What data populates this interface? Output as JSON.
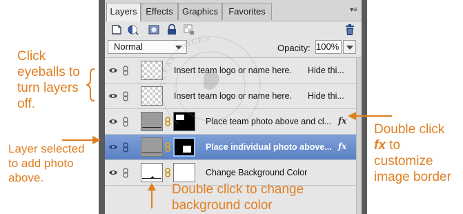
{
  "tabs": [
    "Layers",
    "Effects",
    "Graphics",
    "Favorites"
  ],
  "blend_mode": "Normal",
  "opacity_label": "Opacity:",
  "opacity_value": "100%",
  "layers": [
    {
      "name": "Insert team logo or name here.",
      "hide": "Hide thi...",
      "fx": "",
      "selected": false
    },
    {
      "name": "Insert team logo or name here.",
      "hide": "Hide thi...",
      "fx": "",
      "selected": false
    },
    {
      "name": "Place team photo above and cl...",
      "hide": "",
      "fx": "fx",
      "selected": false
    },
    {
      "name": "Place individual photo above...",
      "hide": "",
      "fx": "fx",
      "selected": true
    },
    {
      "name": "Change Background Color",
      "hide": "",
      "fx": "",
      "selected": false
    }
  ],
  "watermark_text": "TEXAS CHICKS",
  "annotations": {
    "eyeballs": [
      "Click",
      "eyeballs to",
      "turn layers",
      "off."
    ],
    "layer_selected": [
      "Layer selected",
      "to add photo",
      "above."
    ],
    "double_click_fx_1": "Double click",
    "double_click_fx_2": "fx",
    "double_click_fx_3": " to",
    "double_click_fx_4": "customize",
    "double_click_fx_5": "image border",
    "bg_color": [
      "Double click to change",
      "background color"
    ]
  },
  "colors": {
    "annotation": "#e07f22",
    "selection": "#5b81c6"
  },
  "icons": [
    "new-layer-icon",
    "adjustment-layer-icon",
    "mask-icon",
    "lock-all-icon",
    "lock-transparent-icon",
    "trash-icon",
    "eye-icon",
    "link-icon",
    "chain-icon"
  ]
}
